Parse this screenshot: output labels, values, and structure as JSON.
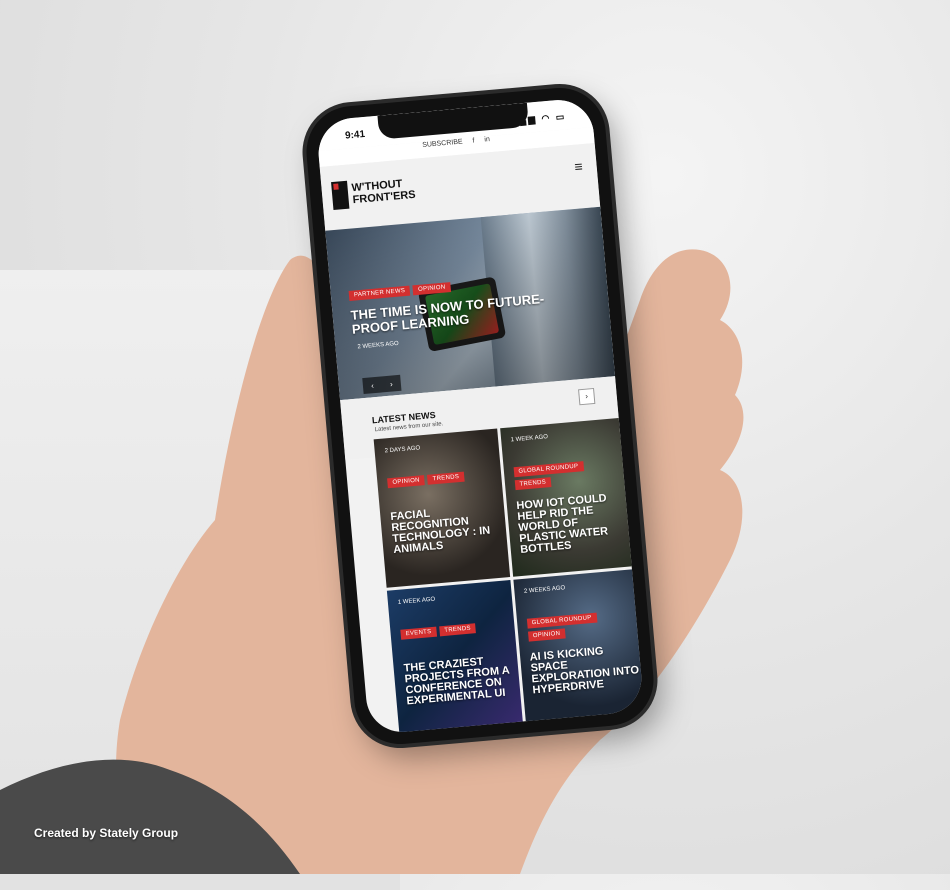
{
  "status": {
    "time": "9:41",
    "icons": "▂▄▆ ◠ ▭"
  },
  "topbar": {
    "subscribe": "SUBSCRIBE",
    "facebook": "f",
    "linkedin": "in"
  },
  "logo": {
    "line1": "W'THOUT",
    "line2": "FRONT'ERS"
  },
  "menu_icon": "≡",
  "hero": {
    "tags": [
      "PARTNER NEWS",
      "OPINION"
    ],
    "title": "THE TIME IS NOW TO FUTURE-PROOF LEARNING",
    "meta": "2 WEEKS AGO",
    "prev": "‹",
    "next": "›"
  },
  "latest": {
    "title": "LATEST NEWS",
    "subtitle": "Latest news from our site.",
    "next": "›"
  },
  "cards": [
    {
      "meta": "2 DAYS AGO",
      "tags": [
        "OPINION",
        "TRENDS"
      ],
      "title": "FACIAL RECOGNITION TECHNOLOGY : IN ANIMALS"
    },
    {
      "meta": "1 WEEK AGO",
      "tags": [
        "GLOBAL ROUNDUP",
        "TRENDS"
      ],
      "title": "HOW IOT COULD HELP RID THE WORLD OF PLASTIC WATER BOTTLES"
    },
    {
      "meta": "1 WEEK AGO",
      "tags": [
        "EVENTS",
        "TRENDS"
      ],
      "title": "THE CRAZIEST PROJECTS FROM A CONFERENCE ON EXPERIMENTAL UI"
    },
    {
      "meta": "2 WEEKS AGO",
      "tags": [
        "GLOBAL ROUNDUP",
        "OPINION"
      ],
      "title": "AI IS KICKING SPACE EXPLORATION INTO HYPERDRIVE"
    }
  ],
  "credit": "Created by Stately Group"
}
